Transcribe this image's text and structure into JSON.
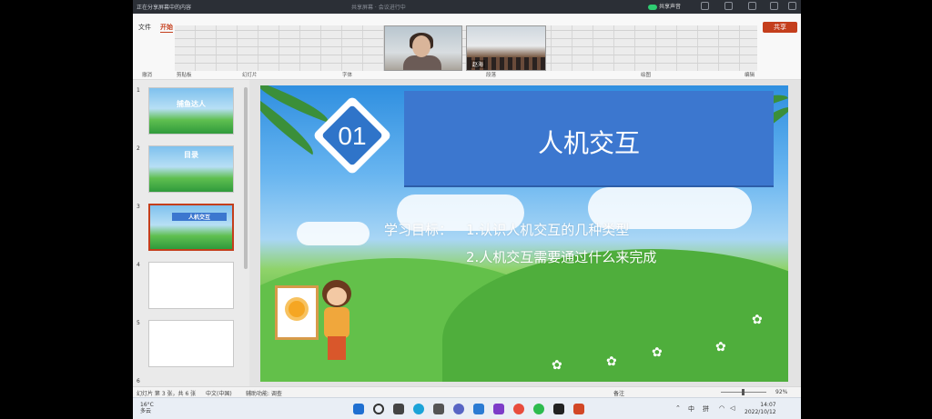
{
  "meeting": {
    "title": "正在分享屏幕中的内容",
    "center_text": "共享屏幕 · 会议进行中",
    "share_audio": "共享声音"
  },
  "ribbon": {
    "tabs": [
      "文件",
      "开始"
    ],
    "share_button": "共享",
    "groups": [
      "撤消",
      "剪贴板",
      "幻灯片",
      "字体",
      "段落",
      "绘图",
      "编辑"
    ]
  },
  "video": {
    "participant2": "赵海"
  },
  "thumbnails": [
    {
      "num": "1",
      "title": "捕鱼达人"
    },
    {
      "num": "2",
      "title": "目录"
    },
    {
      "num": "3",
      "title": "人机交互"
    },
    {
      "num": "4",
      "title": ""
    },
    {
      "num": "5",
      "title": ""
    },
    {
      "num": "6",
      "title": ""
    }
  ],
  "slide": {
    "number": "01",
    "title": "人机交互",
    "objective_label": "学习目标：",
    "objective_1": "1.认识人机交互的几种类型",
    "objective_2": "2.人机交互需要通过什么来完成"
  },
  "status": {
    "slide_info": "幻灯片 第 3 张，共 6 张",
    "language": "中文(中国)",
    "accessibility": "辅助功能: 调查",
    "notes": "备注",
    "zoom": "92%"
  },
  "taskbar": {
    "weather_temp": "16°C",
    "weather_desc": "多云",
    "ime_1": "中",
    "ime_2": "拼",
    "time": "14:07",
    "date": "2022/10/12"
  },
  "colors": {
    "accent": "#c43e1c",
    "slide_title_bg": "#3c77cf"
  }
}
